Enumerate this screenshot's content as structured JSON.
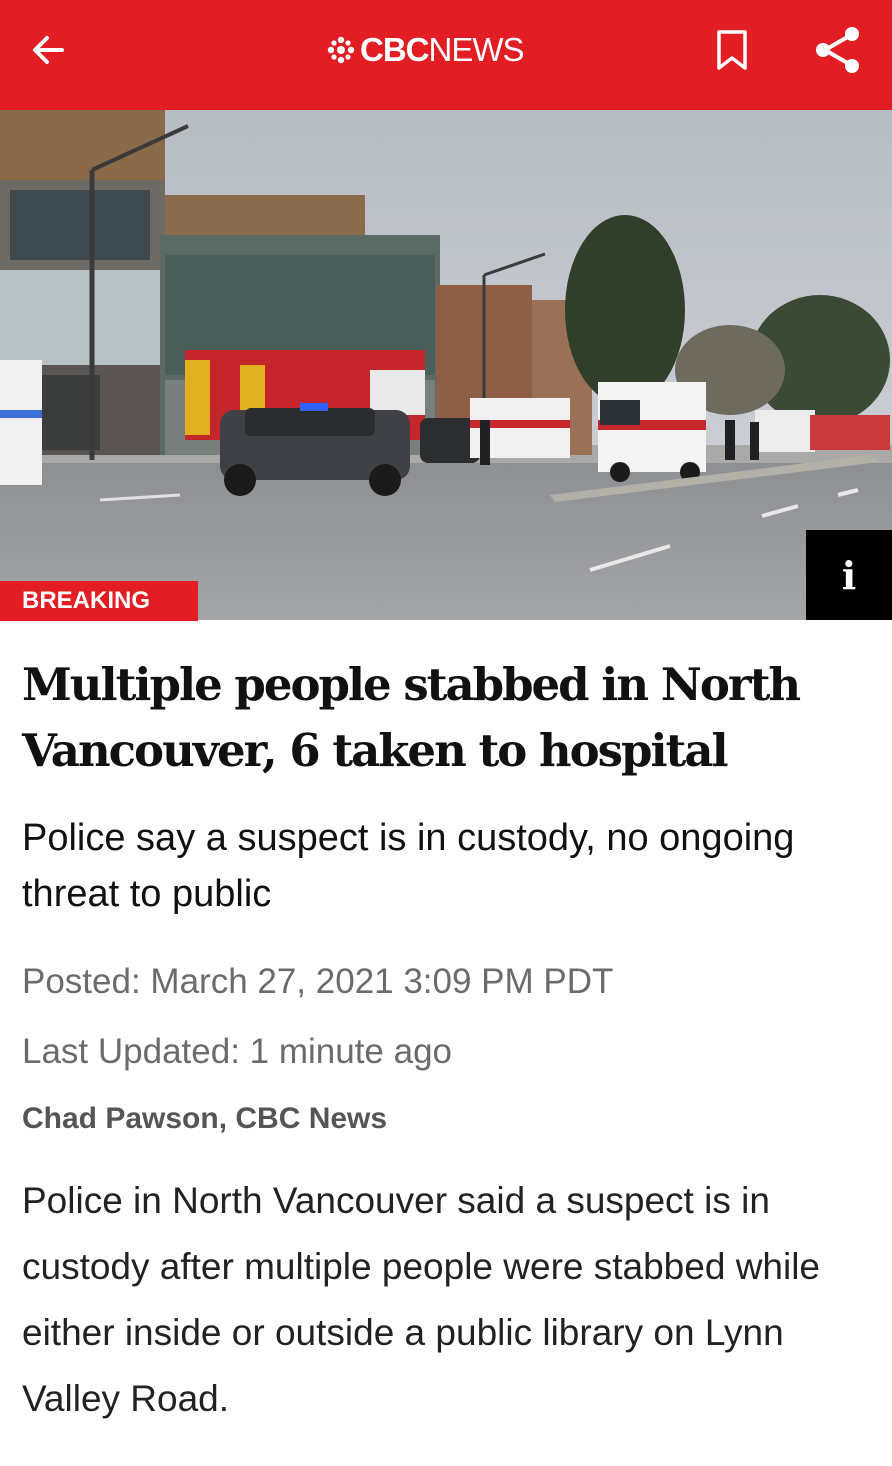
{
  "header": {
    "brand_cbc": "CBC",
    "brand_news": "NEWS",
    "back_icon": "arrow-left-icon",
    "bookmark_icon": "bookmark-icon",
    "share_icon": "share-icon",
    "background_color": "#e21d23"
  },
  "hero": {
    "badge": "BREAKING",
    "info_label": "i"
  },
  "article": {
    "headline": "Multiple people stabbed in North Vancouver, 6 taken to hospital",
    "deck": "Police say a suspect is in custody, no ongoing threat to public",
    "posted": "Posted: March 27, 2021 3:09 PM PDT",
    "last_updated": "Last Updated: 1 minute ago",
    "byline": "Chad Pawson, CBC News",
    "body": "Police in North Vancouver said a suspect is in custody after multiple people were stabbed while either inside or outside a public library on Lynn Valley Road."
  }
}
